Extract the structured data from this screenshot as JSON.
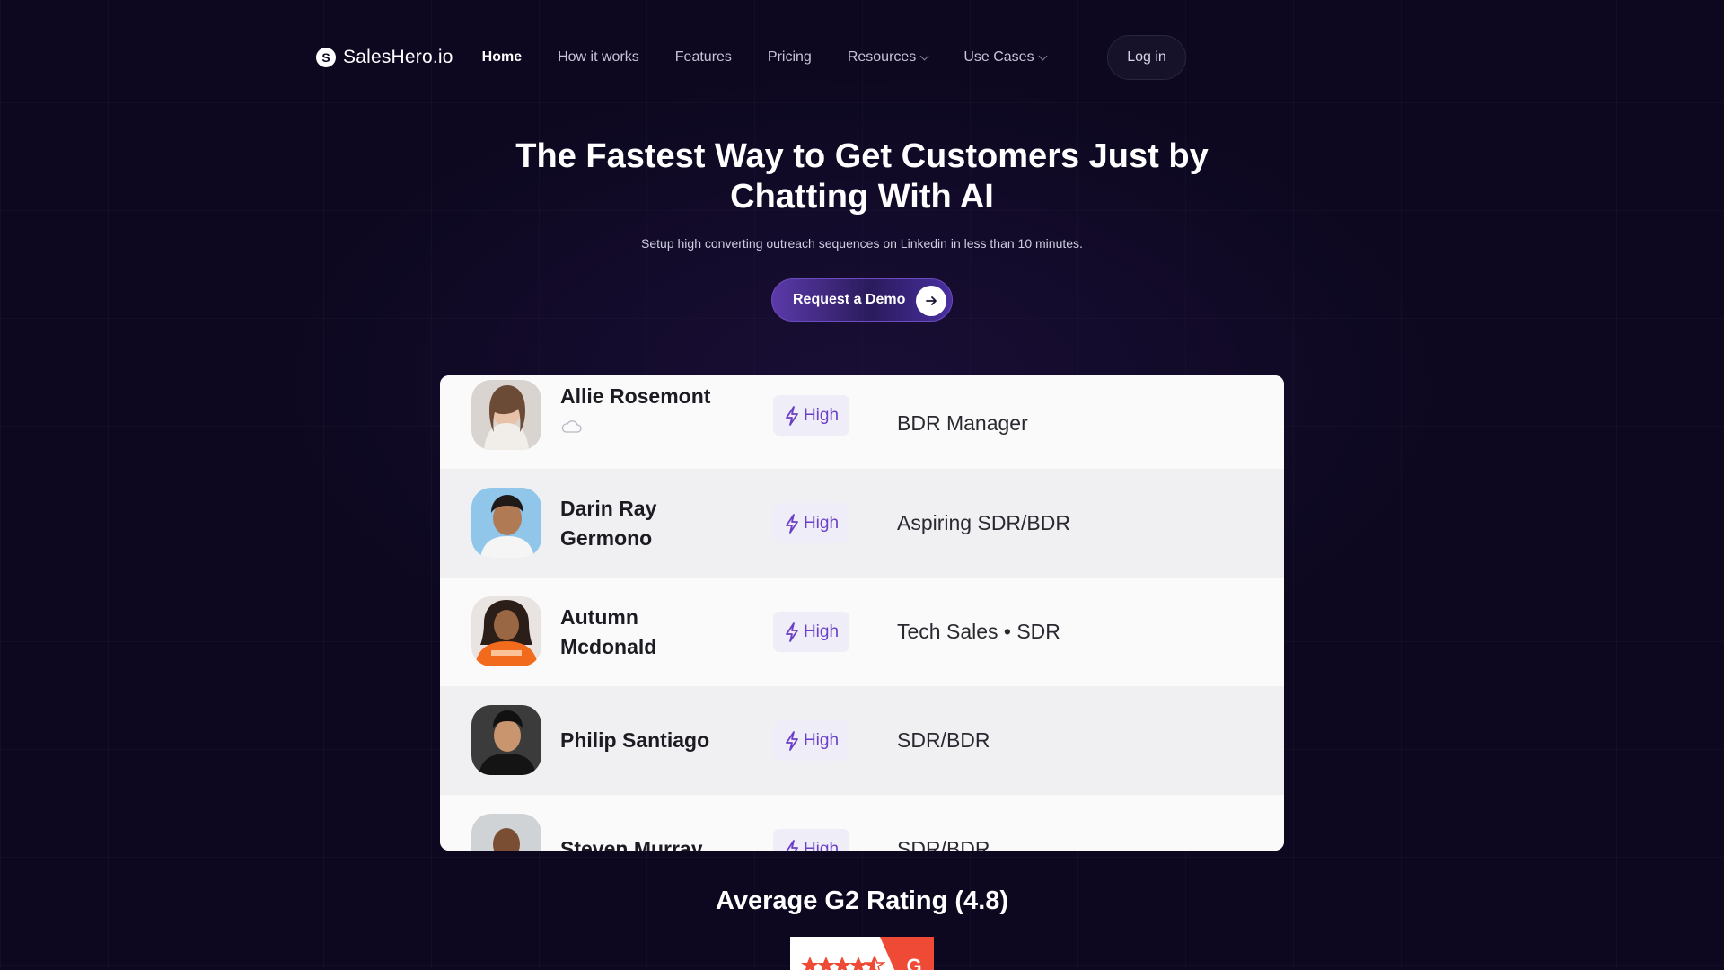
{
  "nav": {
    "brand": "SalesHero.io",
    "brand_mark": "S",
    "items": [
      {
        "label": "Home",
        "active": true,
        "dropdown": false
      },
      {
        "label": "How it works",
        "active": false,
        "dropdown": false
      },
      {
        "label": "Features",
        "active": false,
        "dropdown": false
      },
      {
        "label": "Pricing",
        "active": false,
        "dropdown": false
      },
      {
        "label": "Resources",
        "active": false,
        "dropdown": true
      },
      {
        "label": "Use Cases",
        "active": false,
        "dropdown": true
      }
    ],
    "login_label": "Log in"
  },
  "hero": {
    "title_line1": "The Fastest Way to Get Customers Just by",
    "title_line2": "Chatting With AI",
    "subtitle": "Setup high converting outreach sequences on Linkedin in less than 10 minutes.",
    "cta_label": "Request a Demo"
  },
  "leads": [
    {
      "name": "Allie Rosemont",
      "score": "High",
      "role": "BDR Manager"
    },
    {
      "name": "Darin Ray Germono",
      "score": "High",
      "role": "Aspiring SDR/BDR"
    },
    {
      "name": "Autumn Mcdonald",
      "score": "High",
      "role": "Tech Sales • SDR"
    },
    {
      "name": "Philip Santiago",
      "score": "High",
      "role": "SDR/BDR"
    },
    {
      "name": "Steven Murray",
      "score": "High",
      "role": "SDR/BDR"
    }
  ],
  "rating": {
    "title": "Average G2 Rating (4.8)",
    "stars": 4.5
  },
  "colors": {
    "background": "#0d0820",
    "accent": "#6b3fc7",
    "g2_red": "#ef4a35"
  }
}
